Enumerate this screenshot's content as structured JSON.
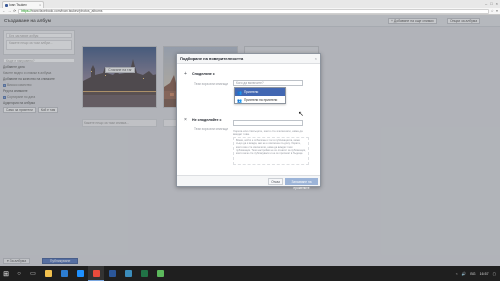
{
  "browser": {
    "tab_title": "Ivan Tsukev",
    "close_glyph": "×",
    "url_https": "https://",
    "url_rest": "www.facebook.com/ivan.tsukev/photos_albums",
    "nav_icons": [
      "back-icon",
      "forward-icon",
      "reload-icon"
    ],
    "window_controls": [
      "–",
      "□",
      "×"
    ]
  },
  "fb": {
    "page_title": "Създаване на албум",
    "add_photos_btn": "+ Добавяне на още снимки",
    "album_settings_btn": "Опции за албума",
    "left": {
      "album_name_placeholder": "Без заглавие албум",
      "description_placeholder": "Кажете нещо за този албум...",
      "location_placeholder": "Къде е направено?",
      "date_label": "Добавете дата",
      "video_note": "Качете видео и снимки в албума",
      "quality_label": "Добавяне на качество на снимките",
      "hd_label": "Високо качество",
      "order_label": "Ред на снимките",
      "sort_label": "Сортиране по дата",
      "audience_label": "Аудитория на албума",
      "btn_a": "Само за приятели",
      "btn_b": "Кой е там"
    },
    "photo_buttons": [
      "Слагане на таг",
      "Слагане на таг"
    ],
    "caption_placeholder": "Кажете нещо за тази снимка...",
    "footer_left": "▾ За албума",
    "footer_publish": "Публикуване"
  },
  "dialog": {
    "title": "Подбиране на поверителността",
    "close_glyph": "×",
    "share_section": "Споделяне с",
    "share_field_label": "Тези хора или списъци",
    "share_placeholder": "Кого да включите?",
    "dropdown": [
      {
        "label": "Приятели",
        "icon": "friends-icon",
        "selected": true
      },
      {
        "label": "Приятели на приятели",
        "icon": "friends-of-friends-icon",
        "selected": false
      }
    ],
    "noshare_section": "Не споделяйте с",
    "noshare_field_label": "Тези хора или списъци",
    "help_text": "Хората или списъците, които сте изключили, няма да виждат това.",
    "note": "Всеки, който е отбелязан с таг в публикацията, може също да я вижда, ако не е изключен по-долу. Хората, които вие сте изключили, няма да виждат тази публикация. Тези настройки не се отнасят за публикации, които вече сте публикували и не се прилагат в бъдеще.",
    "cancel": "Отказ",
    "save": "Запазване на промените"
  },
  "taskbar": {
    "apps": [
      {
        "name": "file-explorer-icon",
        "color": "#f2c14e"
      },
      {
        "name": "edge-icon",
        "color": "#2d7dd2"
      },
      {
        "name": "store-icon",
        "color": "#1e90ff"
      },
      {
        "name": "chrome-icon",
        "color": "#e94b3c",
        "active": true
      },
      {
        "name": "word-icon",
        "color": "#2b579a"
      },
      {
        "name": "movie-icon",
        "color": "#3c8dbc"
      },
      {
        "name": "excel-icon",
        "color": "#217346"
      },
      {
        "name": "green-app-icon",
        "color": "#5cb85c"
      }
    ],
    "time": "16:57",
    "lang": "BG"
  }
}
